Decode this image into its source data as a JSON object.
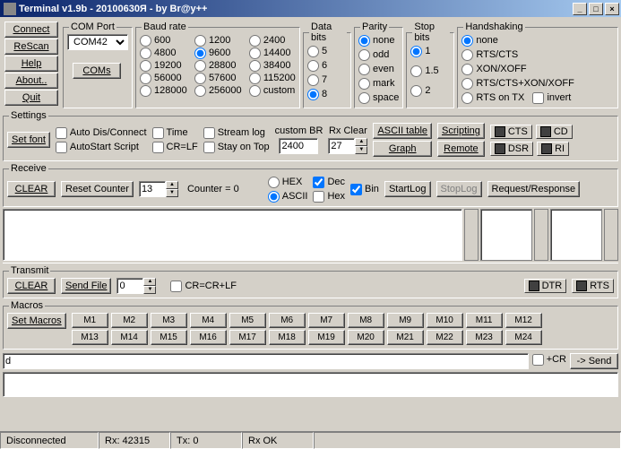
{
  "window": {
    "title": "Terminal v1.9b - 20100630Я - by Br@y++",
    "min": "_",
    "max": "□",
    "close": "×"
  },
  "topButtons": {
    "connect": "Connect",
    "rescan": "ReScan",
    "help": "Help",
    "about": "About..",
    "quit": "Quit"
  },
  "comPort": {
    "legend": "COM Port",
    "value": "COM42",
    "coms": "COMs"
  },
  "baud": {
    "legend": "Baud rate",
    "rates": [
      "600",
      "1200",
      "2400",
      "4800",
      "9600",
      "14400",
      "19200",
      "28800",
      "38400",
      "56000",
      "57600",
      "115200",
      "128000",
      "256000",
      "custom"
    ],
    "selected": "9600"
  },
  "dataBits": {
    "legend": "Data bits",
    "opts": [
      "5",
      "6",
      "7",
      "8"
    ],
    "selected": "8"
  },
  "parity": {
    "legend": "Parity",
    "opts": [
      "none",
      "odd",
      "even",
      "mark",
      "space"
    ],
    "selected": "none"
  },
  "stopBits": {
    "legend": "Stop bits",
    "opts": [
      "1",
      "1.5",
      "2"
    ],
    "selected": "1"
  },
  "handshake": {
    "legend": "Handshaking",
    "opts": [
      "none",
      "RTS/CTS",
      "XON/XOFF",
      "RTS/CTS+XON/XOFF",
      "RTS on TX"
    ],
    "selected": "none",
    "invert": "invert"
  },
  "settings": {
    "legend": "Settings",
    "setFont": "Set font",
    "autoDC": "Auto Dis/Connect",
    "autoStart": "AutoStart Script",
    "time": "Time",
    "crlf": "CR=LF",
    "streamLog": "Stream log",
    "stayTop": "Stay on Top",
    "customBR": "custom BR",
    "customBRval": "2400",
    "rxClear": "Rx Clear",
    "rxClearVal": "27",
    "asciiTable": "ASCII table",
    "graph": "Graph",
    "scripting": "Scripting",
    "remote": "Remote",
    "cts": "CTS",
    "cd": "CD",
    "dsr": "DSR",
    "ri": "RI"
  },
  "receive": {
    "legend": "Receive",
    "clear": "CLEAR",
    "resetCounter": "Reset Counter",
    "counterVal": "13",
    "counterText": "Counter  =  0",
    "hex": "HEX",
    "dec": "Dec",
    "bin": "Bin",
    "ascii": "ASCII",
    "hex2": "Hex",
    "startLog": "StartLog",
    "stopLog": "StopLog",
    "reqResp": "Request/Response"
  },
  "transmit": {
    "legend": "Transmit",
    "clear": "CLEAR",
    "sendFile": "Send File",
    "spinVal": "0",
    "crcrlf": "CR=CR+LF",
    "dtr": "DTR",
    "rts": "RTS"
  },
  "macros": {
    "legend": "Macros",
    "setMacros": "Set Macros",
    "row1": [
      "M1",
      "M2",
      "M3",
      "M4",
      "M5",
      "M6",
      "M7",
      "M8",
      "M9",
      "M10",
      "M11",
      "M12"
    ],
    "row2": [
      "M13",
      "M14",
      "M15",
      "M16",
      "M17",
      "M18",
      "M19",
      "M20",
      "M21",
      "M22",
      "M23",
      "M24"
    ]
  },
  "send": {
    "input": "d",
    "cr": "+CR",
    "send": "-> Send"
  },
  "status": {
    "conn": "Disconnected",
    "rx": "Rx: 42315",
    "tx": "Tx: 0",
    "rxok": "Rx OK"
  }
}
